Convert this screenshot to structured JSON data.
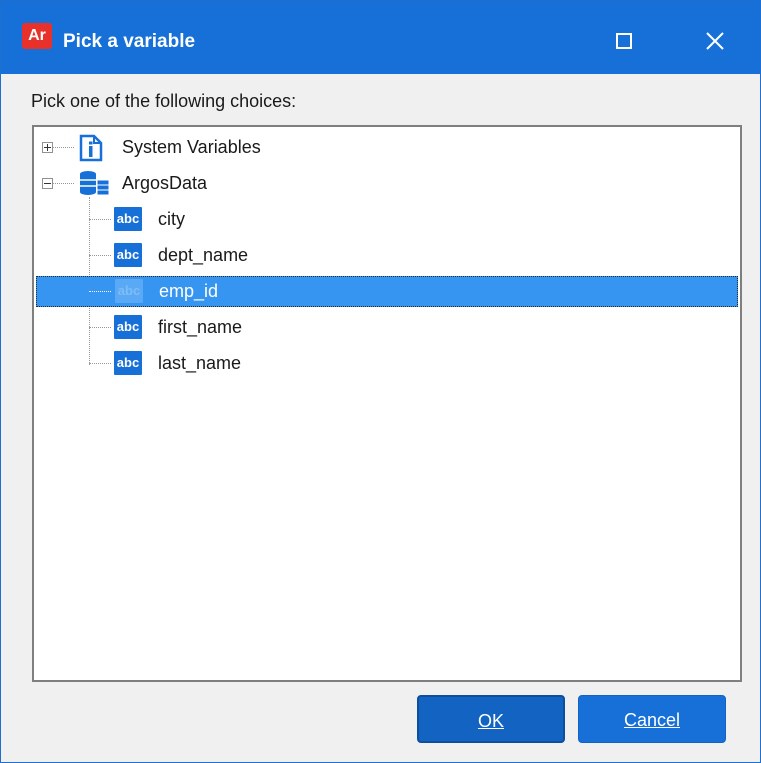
{
  "window": {
    "title": "Pick a variable",
    "app_logo_text": "Ar",
    "accent_color": "#1670d8",
    "logo_color": "#e8312a"
  },
  "prompt": "Pick one of the following choices:",
  "tree": {
    "nodes": [
      {
        "label": "System Variables",
        "icon": "document-icon",
        "expander": "plus"
      },
      {
        "label": "ArgosData",
        "icon": "database-icon",
        "expander": "minus",
        "children": [
          {
            "label": "city",
            "icon": "abc-icon",
            "icon_text": "abc"
          },
          {
            "label": "dept_name",
            "icon": "abc-icon",
            "icon_text": "abc"
          },
          {
            "label": "emp_id",
            "icon": "abc-icon",
            "icon_text": "abc",
            "selected": true
          },
          {
            "label": "first_name",
            "icon": "abc-icon",
            "icon_text": "abc"
          },
          {
            "label": "last_name",
            "icon": "abc-icon",
            "icon_text": "abc"
          }
        ]
      }
    ],
    "selection_color": "#3595f0"
  },
  "buttons": {
    "ok": "OK",
    "cancel": "Cancel"
  }
}
